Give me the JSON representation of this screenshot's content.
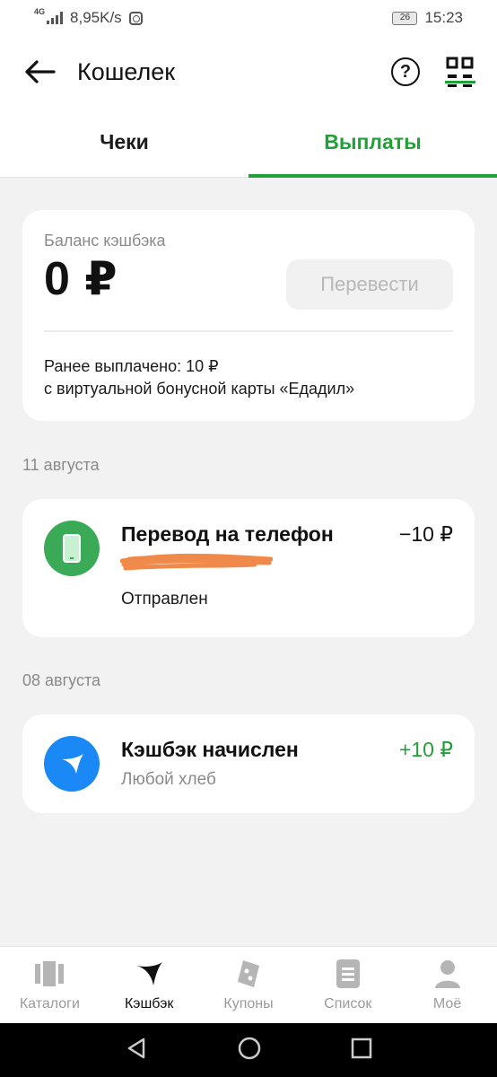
{
  "status_bar": {
    "network": "4G",
    "speed": "8,95K/s",
    "battery": "26",
    "time": "15:23"
  },
  "app_bar": {
    "title": "Кошелек",
    "help_icon": "question-circle-icon",
    "qr_icon": "qr-code-icon"
  },
  "tabs": [
    {
      "label": "Чеки",
      "active": false
    },
    {
      "label": "Выплаты",
      "active": true
    }
  ],
  "balance": {
    "label": "Баланс кэшбэка",
    "value": "0 ₽",
    "transfer_label": "Перевести",
    "paid_line1": "Ранее выплачено: 10 ₽",
    "paid_line2": "с виртуальной бонусной карты «Едадил»"
  },
  "transactions": [
    {
      "date": "11 августа",
      "title": "Перевод на телефон",
      "amount": "−10 ₽",
      "status": "Отправлен",
      "icon": "phone-icon",
      "icon_color": "#3aaa57"
    },
    {
      "date": "08 августа",
      "title": "Кэшбэк начислен",
      "amount": "+10 ₽",
      "subtitle": "Любой хлеб",
      "icon": "boomerang-icon",
      "icon_color": "#1a88f5"
    }
  ],
  "bottom_nav": [
    {
      "label": "Каталоги",
      "icon": "catalogs-icon",
      "active": false
    },
    {
      "label": "Кэшбэк",
      "icon": "boomerang-icon",
      "active": true
    },
    {
      "label": "Купоны",
      "icon": "coupons-icon",
      "active": false
    },
    {
      "label": "Список",
      "icon": "list-icon",
      "active": false
    },
    {
      "label": "Моё",
      "icon": "profile-icon",
      "active": false
    }
  ],
  "colors": {
    "accent_green": "#21a038",
    "phone_green": "#3aaa57",
    "cashback_blue": "#1a88f5",
    "background": "#f2f2f2"
  }
}
